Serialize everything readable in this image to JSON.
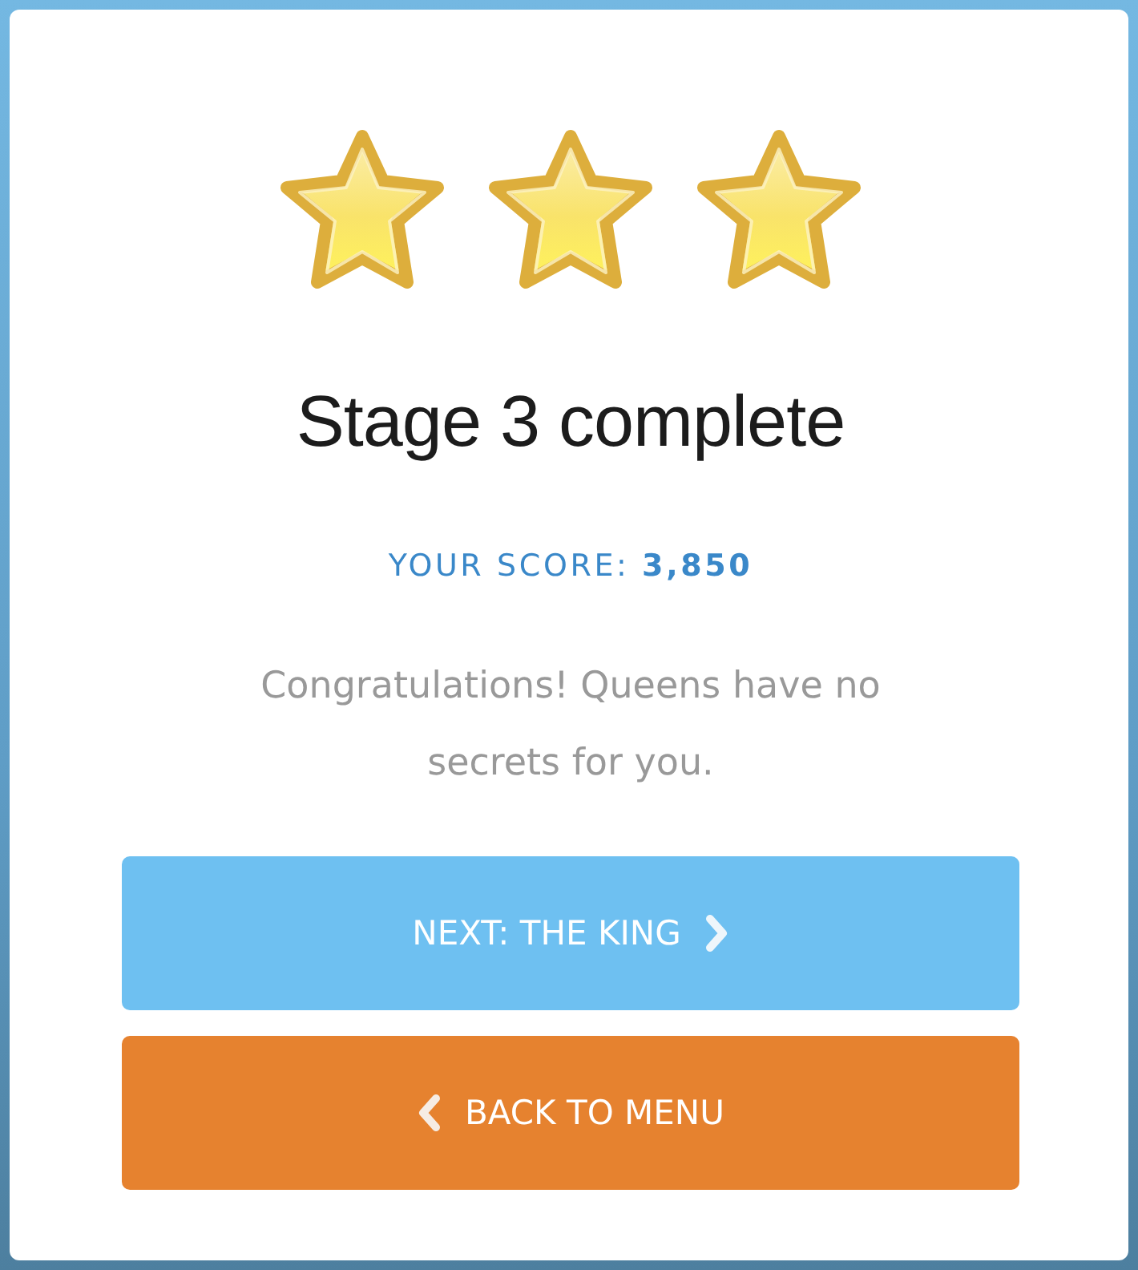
{
  "rating": {
    "stars": 3
  },
  "title": "Stage 3 complete",
  "score": "YOUR SCORE: **3,850**",
  "message": "Congratulations! Queens have no secrets for you.",
  "buttons": [
    {
      "kind": "next",
      "label": "NEXT: THE KING"
    },
    {
      "kind": "back",
      "label": "BACK TO MENU"
    }
  ]
}
